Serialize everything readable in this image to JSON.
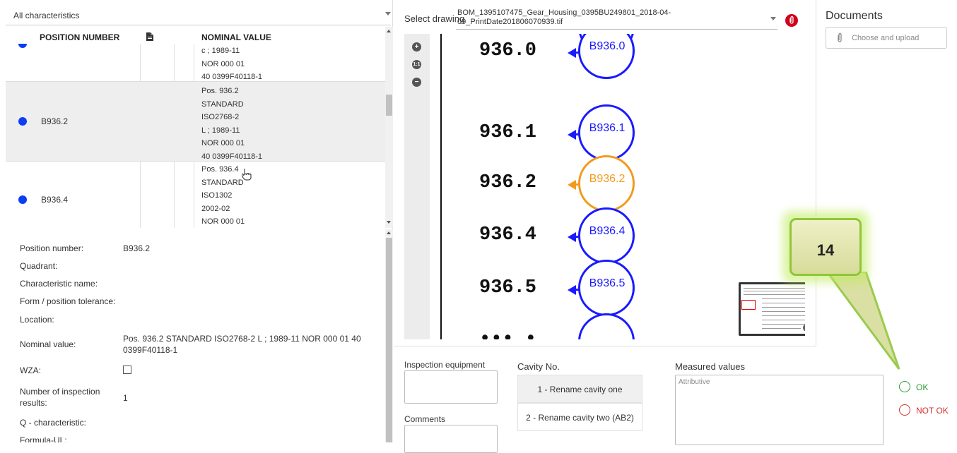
{
  "characteristics_filter": {
    "selected": "All characteristics"
  },
  "table": {
    "headers": {
      "position_number": "POSITION NUMBER",
      "nominal_value": "NOMINAL VALUE"
    },
    "rows": [
      {
        "position": "",
        "nominal_lines": [
          "c ; 1989-11",
          "NOR 000 01",
          "40 0399F40118-1"
        ],
        "selected": false
      },
      {
        "position": "B936.2",
        "nominal_lines": [
          "Pos. 936.2",
          "STANDARD",
          "ISO2768-2",
          "L ; 1989-11",
          "NOR 000 01",
          "40 0399F40118-1"
        ],
        "selected": true
      },
      {
        "position": "B936.4",
        "nominal_lines": [
          "Pos. 936.4",
          "STANDARD",
          "ISO1302",
          "2002-02",
          "NOR 000 01"
        ],
        "selected": false
      }
    ]
  },
  "details": {
    "position_number": {
      "label": "Position number:",
      "value": "B936.2"
    },
    "quadrant": {
      "label": "Quadrant:",
      "value": ""
    },
    "characteristic_name": {
      "label": "Characteristic name:",
      "value": ""
    },
    "form_tolerance": {
      "label": "Form / position tolerance:",
      "value": ""
    },
    "location": {
      "label": "Location:",
      "value": ""
    },
    "nominal_value": {
      "label": "Nominal value:",
      "value_line1": "Pos. 936.2 STANDARD ISO2768-2 L ; 1989-11 NOR 000 01 40",
      "value_line2": "0399F40118-1"
    },
    "wza": {
      "label": "WZA:",
      "checked": false
    },
    "num_results": {
      "label_line1": "Number of inspection",
      "label_line2": "results:",
      "value": "1"
    },
    "q_characteristic": {
      "label": "Q - characteristic:"
    },
    "formula_ul": {
      "label": "Formula-UL:"
    }
  },
  "drawing": {
    "select_label": "Select drawing",
    "file_line1": "BOM_1395107475_Gear_Housing_0395BU249801_2018-04-",
    "file_line2": "09_PrintDate201806070939.tif",
    "zoom_reset_label": "1:1",
    "items": [
      {
        "num": "936.0",
        "balloon": "B936.0",
        "selected": false
      },
      {
        "num": "936.1",
        "balloon": "B936.1",
        "selected": false
      },
      {
        "num": "936.2",
        "balloon": "B936.2",
        "selected": true
      },
      {
        "num": "936.4",
        "balloon": "B936.4",
        "selected": false
      },
      {
        "num": "936.5",
        "balloon": "B936.5",
        "selected": false
      }
    ]
  },
  "inspection": {
    "equipment_label": "Inspection equipment",
    "comments_label": "Comments",
    "cavity_label": "Cavity No.",
    "cavities": [
      "1 - Rename cavity one",
      "2 - Rename cavity two (AB2)"
    ],
    "measured_label": "Measured values",
    "measured_placeholder": "Attributive",
    "ok_label": "OK",
    "not_ok_label": "NOT OK"
  },
  "documents": {
    "title": "Documents",
    "upload_label": "Choose and upload"
  },
  "callout": {
    "number": "14"
  },
  "colors": {
    "accent_blue": "#0a3df5",
    "selected_orange": "#f39a1d",
    "ok_green": "#2e9e3a",
    "not_ok_red": "#d32f2f",
    "attach_red": "#d0021b"
  }
}
